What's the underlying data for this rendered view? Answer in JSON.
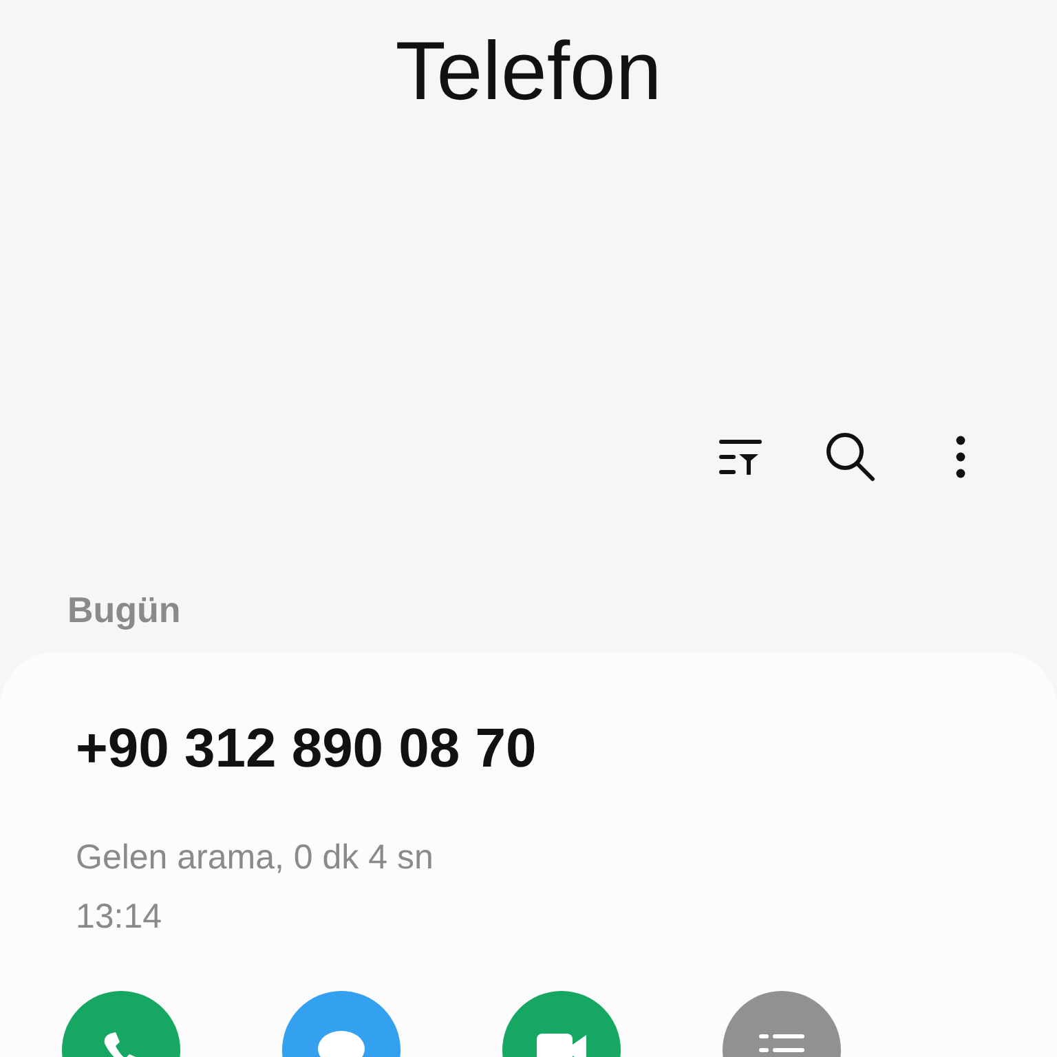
{
  "app": {
    "title": "Telefon"
  },
  "toolbar": [
    {
      "kind": "filter"
    },
    {
      "kind": "search"
    },
    {
      "kind": "more"
    }
  ],
  "section": {
    "label": "Bugün"
  },
  "call_log": [
    {
      "number": "+90 312 890 08 70",
      "description": "Gelen arama, 0 dk 4 sn",
      "time": "13:14",
      "actions": [
        {
          "kind": "call",
          "color": "#16a862"
        },
        {
          "kind": "message",
          "color": "#33a0f0"
        },
        {
          "kind": "video",
          "color": "#16a862"
        },
        {
          "kind": "details",
          "color": "#919191"
        }
      ]
    }
  ]
}
